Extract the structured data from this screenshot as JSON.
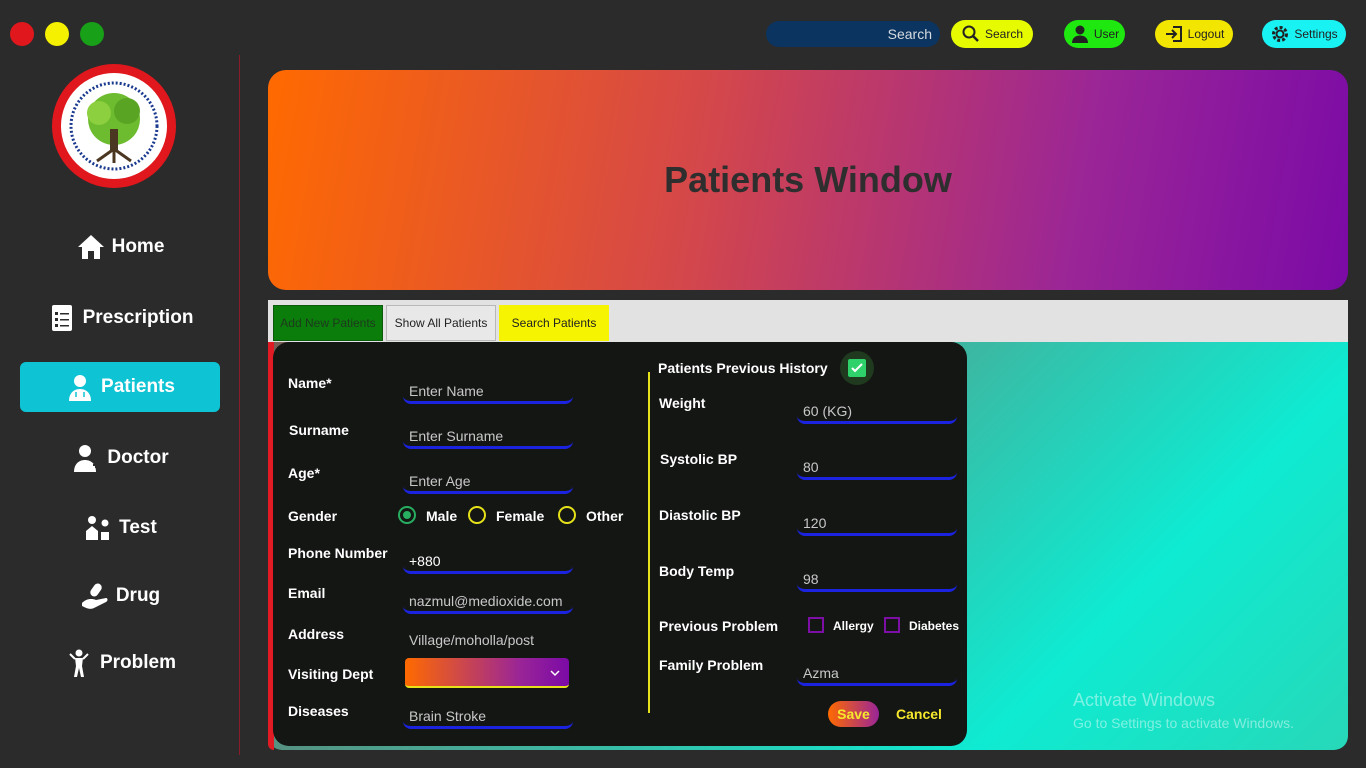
{
  "window_controls": {
    "close_color": "#e0171c",
    "minimize_color": "#f4f000",
    "maximize_color": "#17a018"
  },
  "topbar": {
    "search_field_text": "Search",
    "search_button": "Search",
    "user_button": "User",
    "logout_button": "Logout",
    "settings_button": "Settings",
    "colors": {
      "search": "#e6fa00",
      "user": "#1ee80f",
      "logout": "#f2e600",
      "settings": "#18f2f2"
    }
  },
  "sidebar": {
    "items": [
      {
        "label": "Home",
        "icon": "home-icon",
        "active": false
      },
      {
        "label": "Prescription",
        "icon": "prescription-icon",
        "active": false
      },
      {
        "label": "Patients",
        "icon": "patient-icon",
        "active": true
      },
      {
        "label": "Doctor",
        "icon": "doctor-icon",
        "active": false
      },
      {
        "label": "Test",
        "icon": "test-icon",
        "active": false
      },
      {
        "label": "Drug",
        "icon": "drug-icon",
        "active": false
      },
      {
        "label": "Problem",
        "icon": "problem-icon",
        "active": false
      }
    ]
  },
  "banner": {
    "title": "Patients Window"
  },
  "tabs": [
    {
      "label": "Add New Patients",
      "color": "#0b7d0b"
    },
    {
      "label": "Show All Patients",
      "color": "#e8e8e8"
    },
    {
      "label": "Search Patients",
      "color": "#f6f400"
    }
  ],
  "form": {
    "name_label": "Name*",
    "name_placeholder": "Enter Name",
    "surname_label": "Surname",
    "surname_placeholder": "Enter Surname",
    "age_label": "Age*",
    "age_placeholder": "Enter Age",
    "gender_label": "Gender",
    "gender_options": [
      "Male",
      "Female",
      "Other"
    ],
    "gender_selected": "Male",
    "phone_label": "Phone Number",
    "phone_value": "+880",
    "email_label": "Email",
    "email_value": "nazmul@medioxide.com",
    "address_label": "Address",
    "address_value": "Village/moholla/post",
    "dept_label": "Visiting Dept",
    "diseases_label": "Diseases",
    "diseases_value": "Brain Stroke",
    "history_label": "Patients Previous History",
    "history_checked": true,
    "weight_label": "Weight",
    "weight_value": "60 (KG)",
    "systolic_label": "Systolic BP",
    "systolic_value": "80",
    "diastolic_label": "Diastolic BP",
    "diastolic_value": "120",
    "temp_label": "Body Temp",
    "temp_value": "98",
    "prev_problem_label": "Previous Problem",
    "prev_problem_options": [
      "Allergy",
      "Diabetes"
    ],
    "family_problem_label": "Family Problem",
    "family_problem_value": "Azma",
    "save_button": "Save",
    "cancel_button": "Cancel"
  },
  "watermark": {
    "line1": "Activate Windows",
    "line2": "Go to Settings to activate Windows."
  }
}
